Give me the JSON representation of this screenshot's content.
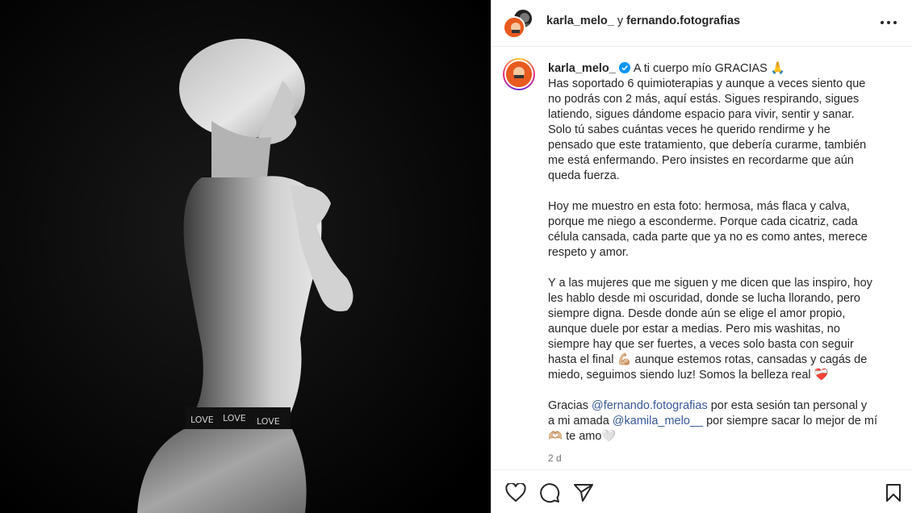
{
  "header": {
    "author": "karla_melo_",
    "conjunction": "y",
    "coauthor": "fernando.fotografias"
  },
  "post": {
    "username": "karla_melo_",
    "verified": true,
    "paragraph1": [
      "A ti cuerpo mío GRACIAS 🙏",
      "Has soportado 6 quimioterapias y aunque a veces siento que",
      "no podrás con 2 más, aquí estás. Sigues respirando, sigues",
      "latiendo, sigues dándome espacio para vivir, sentir y sanar.",
      "Solo tú sabes cuántas veces he querido rendirme y he",
      "pensado que este tratamiento, que debería curarme, también",
      "me está enfermando. Pero insistes en recordarme que aún",
      "queda fuerza."
    ],
    "paragraph2": [
      "Hoy me muestro en esta foto: hermosa, más flaca y calva,",
      "porque me niego a esconderme. Porque cada cicatriz, cada",
      "célula cansada, cada parte que ya no es como antes, merece",
      "respeto y amor."
    ],
    "paragraph3": [
      "Y a las mujeres que me siguen y me dicen que las inspiro, hoy",
      "les hablo desde mi oscuridad, donde se lucha llorando, pero",
      "siempre digna. Desde donde aún se elige el amor propio,",
      "aunque duele por estar a medias. Pero mis washitas, no",
      "siempre hay que ser fuertes, a veces solo basta con seguir",
      "hasta el final 💪🏼 aunque estemos rotas, cansadas y cagás de",
      "miedo, seguimos siendo luz!  Somos la belleza real ❤️‍🩹"
    ],
    "paragraph4": {
      "pre": "Gracias ",
      "mention1": "@fernando.fotografias",
      "mid1": " por esta sesión tan personal y",
      "line2_pre": "a mi amada ",
      "mention2": "@kamila_melo__",
      "line2_post": " por siempre sacar lo mejor de mí",
      "line3": "🫶🏼 te amo🤍"
    },
    "timestamp": "2 d"
  },
  "photo": {
    "waistband_text": [
      "LOVE",
      "LOVE",
      "LOVE"
    ]
  },
  "icons": {
    "more": "more-horizontal-icon",
    "like": "heart-icon",
    "comment": "comment-icon",
    "share": "send-icon",
    "save": "bookmark-icon"
  },
  "colors": {
    "verified": "#0095f6",
    "mention": "#385898",
    "muted": "#737373"
  }
}
